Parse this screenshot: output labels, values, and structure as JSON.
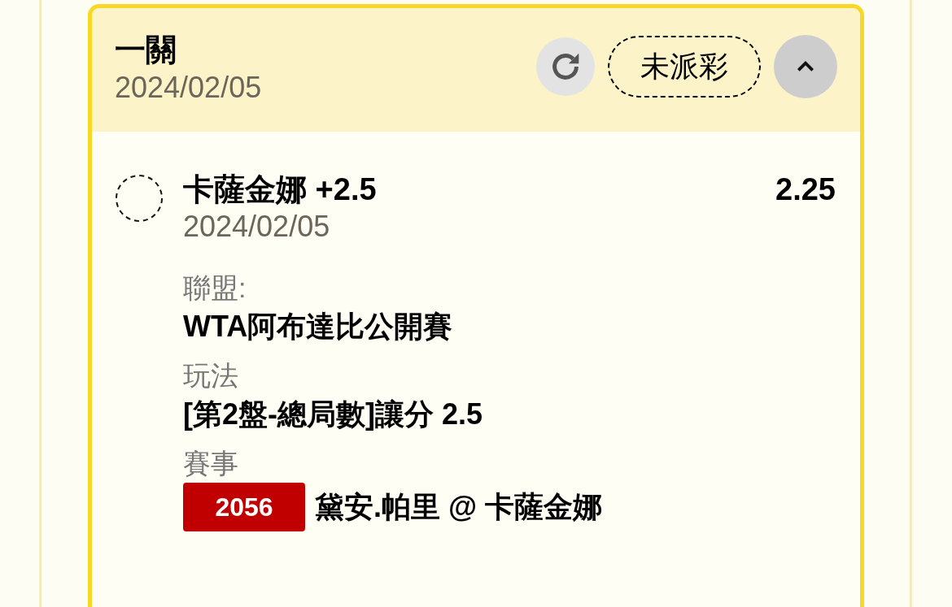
{
  "bet": {
    "title": "一關",
    "date": "2024/02/05",
    "status": "未派彩",
    "expanded": true
  },
  "selections": [
    {
      "name": "卡薩金娜 +2.5",
      "odds": "2.25",
      "date": "2024/02/05",
      "checked": false,
      "details": [
        {
          "label": "聯盟:",
          "value": "WTA阿布達比公開賽"
        },
        {
          "label": "玩法",
          "value": "[第2盤-總局數]讓分 2.5"
        },
        {
          "label": "賽事",
          "badge": "2056",
          "value": "黛安.帕里 @ 卡薩金娜"
        }
      ]
    }
  ]
}
